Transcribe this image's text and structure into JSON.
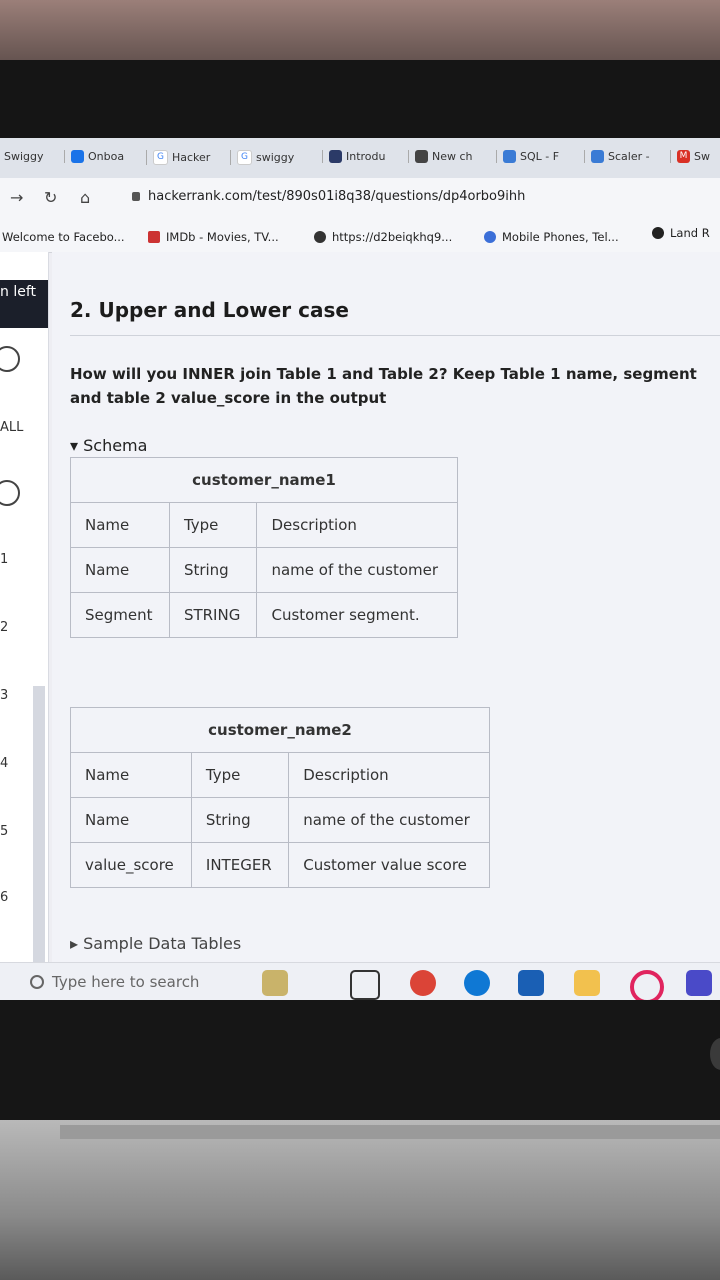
{
  "browser": {
    "tabs": [
      "Swiggy",
      "Onboa",
      "Hacker",
      "swiggy",
      "Introdu",
      "New ch",
      "SQL - F",
      "Scaler -",
      "Sw"
    ],
    "url": "hackerrank.com/test/890s01i8q38/questions/dp4orbo9ihh",
    "bookmarks": [
      "Welcome to Facebo...",
      "IMDb - Movies, TV...",
      "https://d2beiqkhq9...",
      "Mobile Phones, Tel...",
      "Land R"
    ]
  },
  "sidebar": {
    "time_left": "n left",
    "all_label": "ALL",
    "question_numbers": [
      "1",
      "2",
      "3",
      "4",
      "5",
      "6"
    ]
  },
  "question": {
    "title": "2. Upper and Lower case",
    "text": "How will you INNER join Table 1 and Table 2? Keep Table 1 name, segment and table 2 value_score in the output",
    "schema_label": "▾ Schema",
    "sample_label": "▸ Sample Data Tables"
  },
  "tables": [
    {
      "caption": "customer_name1",
      "header": [
        "Name",
        "Type",
        "Description"
      ],
      "rows": [
        [
          "Name",
          "String",
          "name of the customer"
        ],
        [
          "Segment",
          "STRING",
          "Customer segment."
        ]
      ]
    },
    {
      "caption": "customer_name2",
      "header": [
        "Name",
        "Type",
        "Description"
      ],
      "rows": [
        [
          "Name",
          "String",
          "name of the customer"
        ],
        [
          "value_score",
          "INTEGER",
          "Customer value score"
        ]
      ]
    }
  ],
  "taskbar": {
    "search_placeholder": "Type here to search"
  }
}
